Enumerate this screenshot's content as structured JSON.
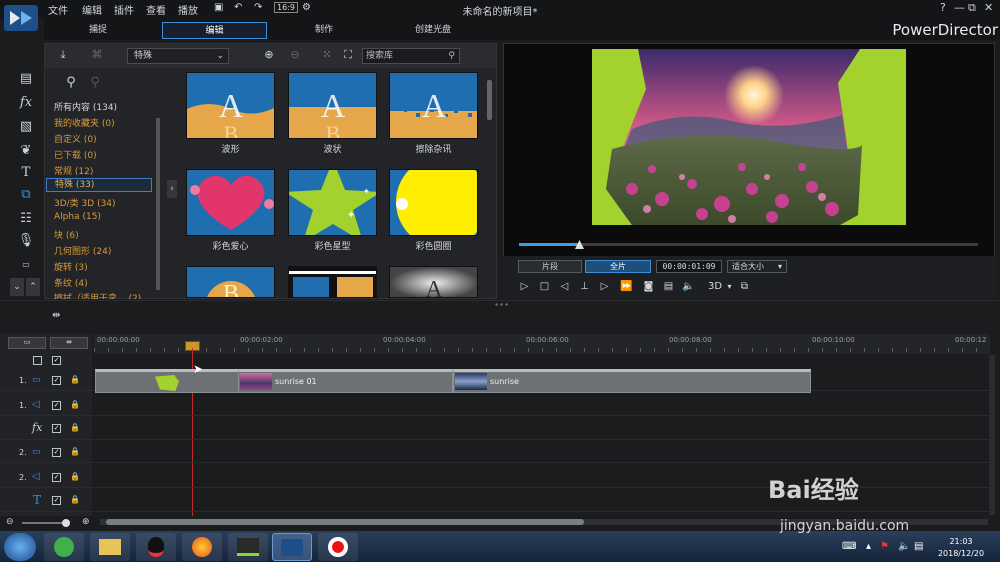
{
  "menu": [
    "文件",
    "编辑",
    "插件",
    "查看",
    "播放"
  ],
  "window_title": "未命名的新项目*",
  "window_controls": {
    "help": "?",
    "minimize": "—",
    "restore": "⧉",
    "close": "✕"
  },
  "modes": [
    {
      "label": "捕捉",
      "active": false
    },
    {
      "label": "编辑",
      "active": true
    },
    {
      "label": "制作",
      "active": false
    },
    {
      "label": "创建光盘",
      "active": false
    }
  ],
  "brand": "PowerDirector",
  "library": {
    "category_select": "特殊",
    "search_placeholder": "搜索库",
    "categories": [
      {
        "label": "所有内容 (134)"
      },
      {
        "label": "我的收藏夹  (0)"
      },
      {
        "label": "自定义  (0)"
      },
      {
        "label": "已下载  (0)"
      },
      {
        "label": "常规  (12)"
      },
      {
        "label": "特殊  (33)",
        "selected": true
      },
      {
        "label": "3D/类 3D  (34)"
      },
      {
        "label": "Alpha  (15)"
      },
      {
        "label": "块  (6)"
      },
      {
        "label": "几何图形  (24)"
      },
      {
        "label": "旋转  (3)"
      },
      {
        "label": "条纹  (4)"
      },
      {
        "label": "擦拭（适用于拿...  (2)"
      }
    ],
    "thumbnails": [
      {
        "label": "波形",
        "icon": "wave-transition-icon"
      },
      {
        "label": "波状",
        "icon": "ripple-transition-icon"
      },
      {
        "label": "擦除杂讯",
        "icon": "noise-wipe-transition-icon"
      },
      {
        "label": "彩色爱心",
        "icon": "heart-transition-icon"
      },
      {
        "label": "彩色星型",
        "icon": "star-transition-icon"
      },
      {
        "label": "彩色圆圈",
        "icon": "circle-transition-icon"
      },
      {
        "label": "",
        "icon": "coin-transition-icon"
      },
      {
        "label": "",
        "icon": "film-strip-transition-icon"
      },
      {
        "label": "",
        "icon": "spotlight-transition-icon"
      }
    ]
  },
  "preview": {
    "segment_label": "片段",
    "full_label": "全片",
    "timecode": "00:00:01:09",
    "fit_label": "适合大小",
    "three_d_label": "3D",
    "progress": 0.13
  },
  "timeline": {
    "ticks": [
      "00:00:00:00",
      "00:00:02:00",
      "00:00:04:00",
      "00:00:06:00",
      "00:00:08:00",
      "00:00:10:00",
      "00:00:12"
    ],
    "tracks": [
      {
        "num": "1.",
        "icon": "video-track-icon"
      },
      {
        "num": "1.",
        "icon": "audio-track-icon"
      },
      {
        "num": "",
        "icon": "fx-track-icon"
      },
      {
        "num": "2.",
        "icon": "video-track-icon"
      },
      {
        "num": "2.",
        "icon": "audio-track-icon"
      },
      {
        "num": "",
        "icon": "title-track-icon"
      }
    ],
    "clips": [
      {
        "label": ""
      },
      {
        "label": "sunrise 01"
      },
      {
        "label": "sunrise"
      }
    ]
  },
  "taskbar": {
    "time": "21:03",
    "date": "2018/12/20"
  },
  "watermark": {
    "text": "Bai经验",
    "url": "jingyan.baidu.com"
  },
  "colors": {
    "accent": "#3d8ed8",
    "category": "#d89a3a",
    "chroma": "#a3d22f"
  }
}
